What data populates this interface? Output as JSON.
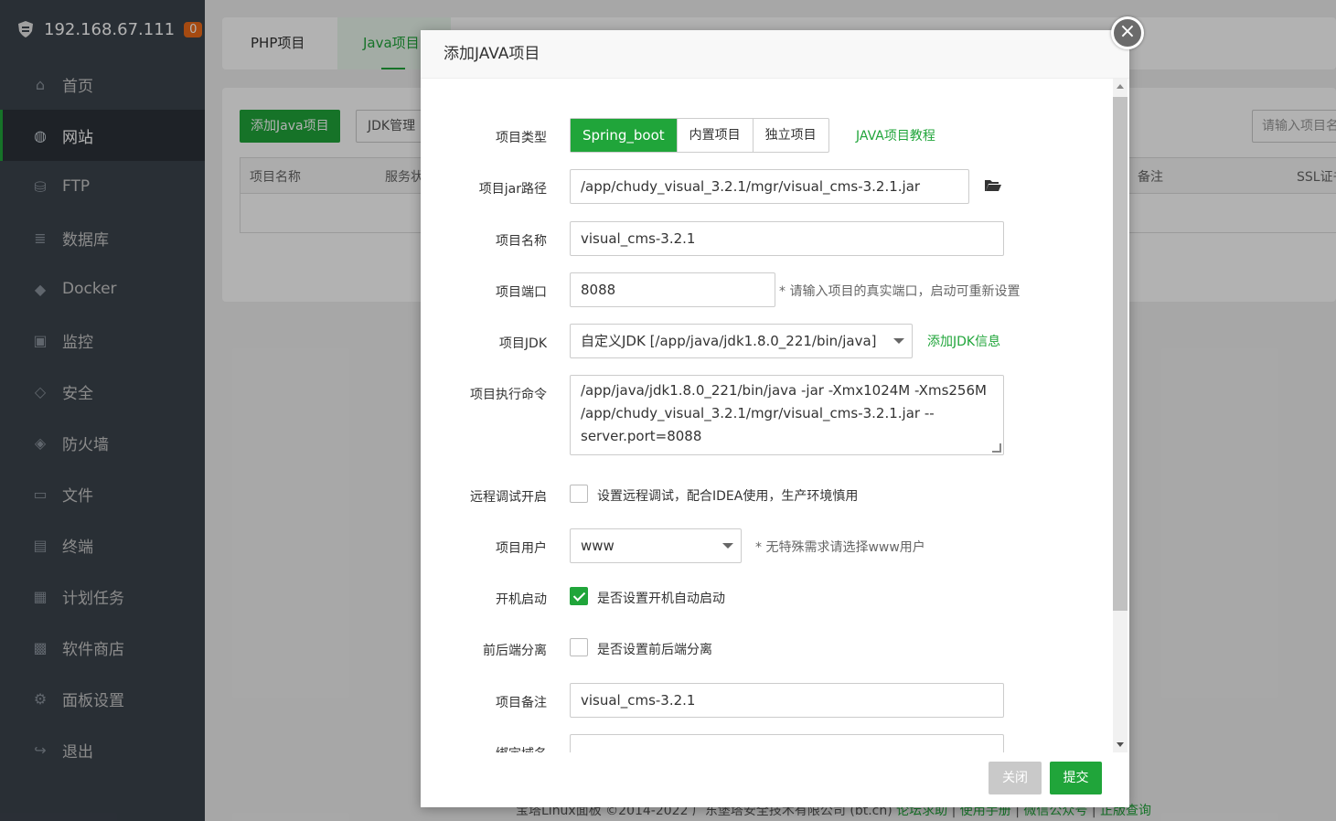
{
  "sidebar": {
    "host": "192.168.67.111",
    "badge": "0",
    "items": [
      {
        "label": "首页",
        "icon": "home-icon"
      },
      {
        "label": "网站",
        "icon": "globe-icon",
        "active": true
      },
      {
        "label": "FTP",
        "icon": "ftp-icon"
      },
      {
        "label": "数据库",
        "icon": "database-icon"
      },
      {
        "label": "Docker",
        "icon": "docker-icon"
      },
      {
        "label": "监控",
        "icon": "monitor-icon"
      },
      {
        "label": "安全",
        "icon": "shield-check-icon"
      },
      {
        "label": "防火墙",
        "icon": "firewall-icon"
      },
      {
        "label": "文件",
        "icon": "folder-icon"
      },
      {
        "label": "终端",
        "icon": "terminal-icon"
      },
      {
        "label": "计划任务",
        "icon": "calendar-icon"
      },
      {
        "label": "软件商店",
        "icon": "apps-icon"
      },
      {
        "label": "面板设置",
        "icon": "gear-icon"
      },
      {
        "label": "退出",
        "icon": "logout-icon"
      }
    ]
  },
  "tabs": {
    "php": "PHP项目",
    "java": "Java项目"
  },
  "toolbar": {
    "add_java": "添加Java项目",
    "jdk_manage": "JDK管理",
    "search_placeholder": "请输入项目名"
  },
  "table": {
    "col_name": "项目名称",
    "col_status": "服务状",
    "col_remark": "备注",
    "col_ssl": "SSL证书"
  },
  "footer": {
    "copyright": "宝塔Linux面板 ©2014-2022 广东堡塔安全技术有限公司 (bt.cn)",
    "links": [
      "论坛求助",
      "使用手册",
      "微信公众号",
      "正版查询"
    ]
  },
  "modal": {
    "title": "添加JAVA项目",
    "close_icon": "×",
    "labels": {
      "type": "项目类型",
      "jar_path": "项目jar路径",
      "name": "项目名称",
      "port": "项目端口",
      "jdk": "项目JDK",
      "command": "项目执行命令",
      "remote_debug": "远程调试开启",
      "user": "项目用户",
      "autostart": "开机启动",
      "separation": "前后端分离",
      "remark": "项目备注",
      "domain": "绑定域名"
    },
    "type_options": [
      "Spring_boot",
      "内置项目",
      "独立项目"
    ],
    "type_selected": "Spring_boot",
    "tutorial_link": "JAVA项目教程",
    "jar_path_value": "/app/chudy_visual_3.2.1/mgr/visual_cms-3.2.1.jar",
    "name_value": "visual_cms-3.2.1",
    "port_value": "8088",
    "port_hint": "* 请输入项目的真实端口，启动可重新设置",
    "jdk_value": "自定义JDK [/app/java/jdk1.8.0_221/bin/java]",
    "add_jdk_link": "添加JDK信息",
    "command_lines": [
      "/app/java/jdk1.8.0_221/bin/java -jar -Xmx1024M -Xms256M",
      "/app/chudy_visual_3.2.1/mgr/visual_cms-3.2.1.jar --",
      "server.port=8088"
    ],
    "remote_debug_text": "设置远程调试，配合IDEA使用，生产环境慎用",
    "remote_debug_checked": false,
    "user_value": "www",
    "user_hint": "* 无特殊需求请选择www用户",
    "autostart_text": "是否设置开机自动启动",
    "autostart_checked": true,
    "separation_text": "是否设置前后端分离",
    "separation_checked": false,
    "remark_value": "visual_cms-3.2.1",
    "domain_value": "",
    "btn_close": "关闭",
    "btn_submit": "提交"
  },
  "colors": {
    "accent": "#20a53a",
    "sidebar": "#3c444d",
    "badge": "#ec6b19"
  }
}
